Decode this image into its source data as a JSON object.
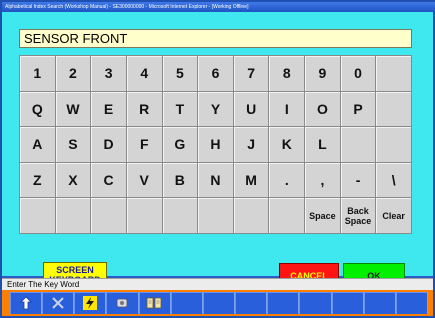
{
  "window": {
    "title": "Alphabetical Index Search (Workshop Manual) - SE300000000 - Microsoft Internet Explorer - [Working Offline]"
  },
  "search": {
    "value": "SENSOR FRONT"
  },
  "keyboard": {
    "rows": [
      [
        "1",
        "2",
        "3",
        "4",
        "5",
        "6",
        "7",
        "8",
        "9",
        "0",
        ""
      ],
      [
        "Q",
        "W",
        "E",
        "R",
        "T",
        "Y",
        "U",
        "I",
        "O",
        "P",
        ""
      ],
      [
        "A",
        "S",
        "D",
        "F",
        "G",
        "H",
        "J",
        "K",
        "L",
        "",
        ""
      ],
      [
        "Z",
        "X",
        "C",
        "V",
        "B",
        "N",
        "M",
        ".",
        ",",
        "-",
        "\\"
      ],
      [
        "",
        "",
        "",
        "",
        "",
        "",
        "",
        "",
        "Space",
        "Back\nSpace",
        "Clear"
      ]
    ]
  },
  "buttons": {
    "screen_keyboard": "SCREEN\nKEYBOARD",
    "cancel": "CANCEL",
    "ok": "OK"
  },
  "status": {
    "text": "Enter The Key Word"
  },
  "toolbar": {
    "icons": [
      "return-icon",
      "cross-tools-icon",
      "lightning-icon",
      "parts-icon",
      "book-icon",
      "",
      "",
      "",
      "",
      "",
      "",
      "",
      ""
    ]
  },
  "colors": {
    "client_bg": "#3ee8ee",
    "toolbar_frame": "#ff8000",
    "toolbar_bg": "#2a5fdc"
  }
}
